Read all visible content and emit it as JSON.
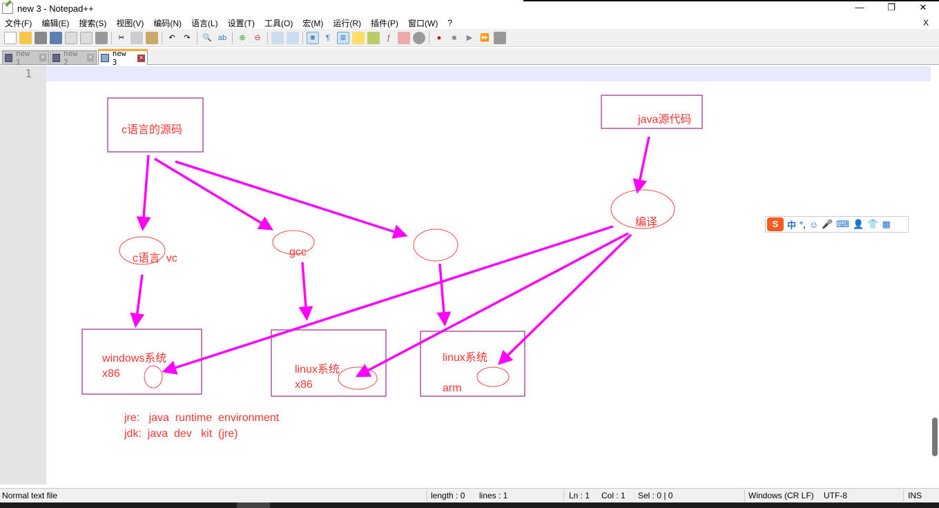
{
  "window": {
    "title": "new 3 - Notepad++",
    "controls": [
      "—",
      "❐",
      "✕"
    ]
  },
  "menu": [
    "文件(F)",
    "编辑(E)",
    "搜索(S)",
    "视图(V)",
    "编码(N)",
    "语言(L)",
    "设置(T)",
    "工具(O)",
    "宏(M)",
    "运行(R)",
    "插件(P)",
    "窗口(W)",
    "?"
  ],
  "menu_close": "X",
  "tabs": [
    {
      "label": "new 1",
      "active": false
    },
    {
      "label": "new 2",
      "active": false
    },
    {
      "label": "new 3",
      "active": true
    }
  ],
  "editor": {
    "line_number": "1"
  },
  "drawing": {
    "c_source": "c语言的源码",
    "java_source": "java源代码",
    "compile": "编译",
    "c_vc": "c语言  vc",
    "gcc": "gcc",
    "windows_os": "windows系统",
    "windows_arch": "x86",
    "linux_os_1": "linux系统",
    "linux_arch_1": "x86",
    "linux_os_2": "linux系统",
    "linux_arch_2": "arm",
    "jre_note": "jre:   java  runtime  environment",
    "jdk_note": "jdk:  java  dev   kit  (jre)",
    "colors": {
      "text": "#ff3333",
      "box": "#b24fa8",
      "arrow": "#ff00ff",
      "ellipse": "#ff4444"
    }
  },
  "ime": {
    "mode": "中",
    "punct": "°,"
  },
  "status": {
    "file_type": "Normal text file",
    "length": "length : 0",
    "lines": "lines : 1",
    "ln": "Ln : 1",
    "col": "Col : 1",
    "sel": "Sel : 0 | 0",
    "eol": "Windows (CR LF)",
    "encoding": "UTF-8",
    "mode": "INS"
  }
}
